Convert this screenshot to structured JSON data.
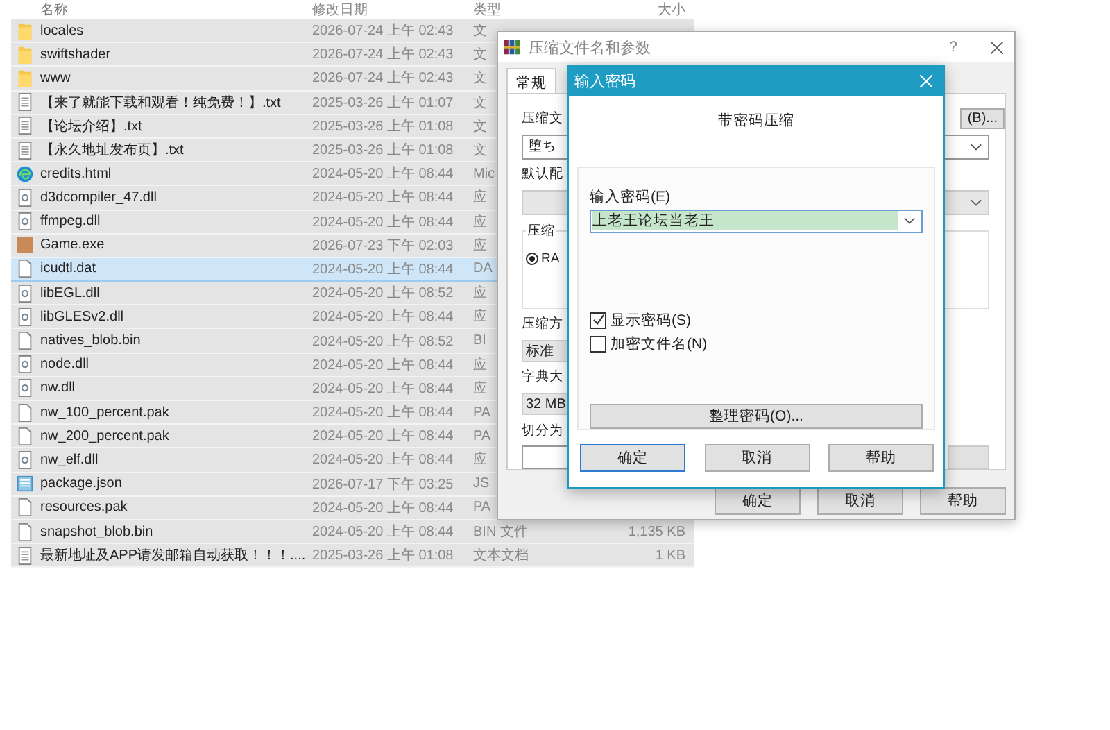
{
  "file_list": {
    "columns": [
      "名称",
      "修改日期",
      "类型",
      "大小"
    ],
    "rows": [
      {
        "kind": "folder",
        "name": "locales",
        "date": "2026-07-24 上午 02:43",
        "type": "文",
        "selected": false
      },
      {
        "kind": "folder",
        "name": "swiftshader",
        "date": "2026-07-24 上午 02:43",
        "type": "文",
        "selected": false
      },
      {
        "kind": "folder",
        "name": "www",
        "date": "2026-07-24 上午 02:43",
        "type": "文",
        "selected": false
      },
      {
        "kind": "text",
        "name": "【来了就能下载和观看！纯免费！】.txt",
        "date": "2025-03-26 上午 01:07",
        "type": "文",
        "selected": false
      },
      {
        "kind": "text",
        "name": "【论坛介绍】.txt",
        "date": "2025-03-26 上午 01:08",
        "type": "文",
        "selected": false
      },
      {
        "kind": "text",
        "name": "【永久地址发布页】.txt",
        "date": "2025-03-26 上午 01:08",
        "type": "文",
        "selected": false
      },
      {
        "kind": "web",
        "name": "credits.html",
        "date": "2024-05-20 上午 08:44",
        "type": "Mic",
        "selected": false
      },
      {
        "kind": "dll",
        "name": "d3dcompiler_47.dll",
        "date": "2024-05-20 上午 08:44",
        "type": "应",
        "selected": false
      },
      {
        "kind": "dll",
        "name": "ffmpeg.dll",
        "date": "2024-05-20 上午 08:44",
        "type": "应",
        "selected": false
      },
      {
        "kind": "app",
        "name": "Game.exe",
        "date": "2026-07-23 下午 02:03",
        "type": "应",
        "selected": false
      },
      {
        "kind": "file",
        "name": "icudtl.dat",
        "date": "2024-05-20 上午 08:44",
        "type": "DA",
        "selected": true
      },
      {
        "kind": "dll",
        "name": "libEGL.dll",
        "date": "2024-05-20 上午 08:52",
        "type": "应",
        "selected": false
      },
      {
        "kind": "dll",
        "name": "libGLESv2.dll",
        "date": "2024-05-20 上午 08:44",
        "type": "应",
        "selected": false
      },
      {
        "kind": "file",
        "name": "natives_blob.bin",
        "date": "2024-05-20 上午 08:52",
        "type": "BI",
        "selected": false
      },
      {
        "kind": "dll",
        "name": "node.dll",
        "date": "2024-05-20 上午 08:44",
        "type": "应",
        "selected": false
      },
      {
        "kind": "dll",
        "name": "nw.dll",
        "date": "2024-05-20 上午 08:44",
        "type": "应",
        "selected": false
      },
      {
        "kind": "file",
        "name": "nw_100_percent.pak",
        "date": "2024-05-20 上午 08:44",
        "type": "PA",
        "selected": false
      },
      {
        "kind": "file",
        "name": "nw_200_percent.pak",
        "date": "2024-05-20 上午 08:44",
        "type": "PA",
        "selected": false
      },
      {
        "kind": "dll",
        "name": "nw_elf.dll",
        "date": "2024-05-20 上午 08:44",
        "type": "应",
        "selected": false
      },
      {
        "kind": "json",
        "name": "package.json",
        "date": "2026-07-17 下午 03:25",
        "type": "JS",
        "selected": false
      },
      {
        "kind": "file",
        "name": "resources.pak",
        "date": "2024-05-20 上午 08:44",
        "type": "PA",
        "selected": false
      },
      {
        "kind": "file",
        "name": "snapshot_blob.bin",
        "date": "2024-05-20 上午 08:44",
        "type": "BIN 文件",
        "size": "1,135 KB",
        "selected": false
      },
      {
        "kind": "text",
        "name": "最新地址及APP请发邮箱自动获取！！！....",
        "date": "2025-03-26 上午 01:08",
        "type": "文本文档",
        "size": "1 KB",
        "selected": false
      }
    ]
  },
  "archive_dialog": {
    "title": "压缩文件名和参数",
    "help_button": "?",
    "tab": "常规",
    "panel": [
      {
        "kind": "label",
        "text": "压缩文",
        "right": "(B)..."
      },
      {
        "kind": "combo",
        "text": "堕ち"
      },
      {
        "kind": "label",
        "text": "默认配"
      },
      {
        "kind": "gray-combo"
      },
      {
        "kind": "group",
        "text": "压缩",
        "option": {
          "label": "RA",
          "selected": true
        }
      },
      {
        "kind": "label",
        "text": "压缩方"
      },
      {
        "kind": "box",
        "text": "标准"
      },
      {
        "kind": "label",
        "text": "字典大"
      },
      {
        "kind": "box",
        "text": "32 MB"
      },
      {
        "kind": "label",
        "text": "切分为"
      },
      {
        "kind": "input"
      }
    ],
    "buttons": [
      "确定",
      "取消",
      "帮助"
    ]
  },
  "password_dialog": {
    "title": "输入密码",
    "heading": "带密码压缩",
    "field_label": "输入密码(E)",
    "password": "上老王论坛当老王",
    "checkboxes": [
      {
        "label": "显示密码(S)",
        "checked": true
      },
      {
        "label": "加密文件名(N)",
        "checked": false
      }
    ],
    "manage_button": "整理密码(O)...",
    "buttons": [
      {
        "label": "确定",
        "focused": true
      },
      {
        "label": "取消",
        "focused": false
      },
      {
        "label": "帮助",
        "focused": false
      }
    ]
  }
}
